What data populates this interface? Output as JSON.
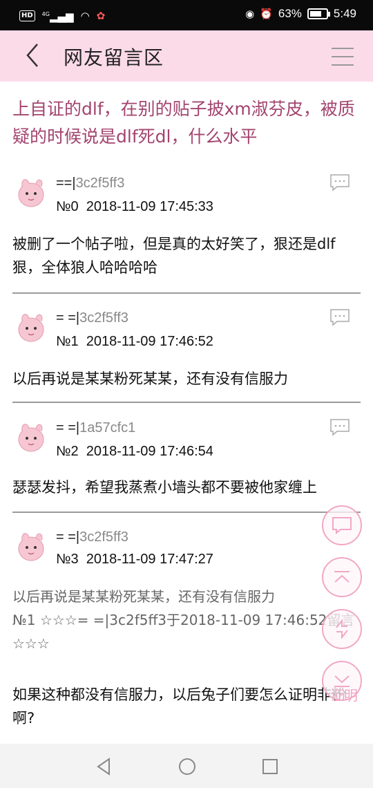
{
  "status_bar": {
    "hd_label": "HD",
    "network_label": "4G",
    "battery_percent": "63%",
    "battery_level": 0.63,
    "time": "5:49"
  },
  "header": {
    "title": "网友留言区"
  },
  "topic": {
    "title": "上自证的dlf，在别的贴子披xm淑芬皮，被质疑的时候说是dlf死dl，什么水平"
  },
  "posts": [
    {
      "author_prefix": "==|",
      "author_id": "3c2f5ff3",
      "floor": "№0",
      "timestamp": "2018-11-09 17:45:33",
      "body": "被删了一个帖子啦，但是真的太好笑了，狠还是dlf狠，全体狼人哈哈哈哈"
    },
    {
      "author_prefix": "= =|",
      "author_id": "3c2f5ff3",
      "floor": "№1",
      "timestamp": "2018-11-09 17:46:52",
      "body": "以后再说是某某粉死某某，还有没有信服力"
    },
    {
      "author_prefix": "= =|",
      "author_id": "1a57cfc1",
      "floor": "№2",
      "timestamp": "2018-11-09 17:46:54",
      "body": "瑟瑟发抖，希望我蒸煮小墙头都不要被他家缠上"
    },
    {
      "author_prefix": "= =|",
      "author_id": "3c2f5ff3",
      "floor": "№3",
      "timestamp": "2018-11-09 17:47:27",
      "quote": "以后再说是某某粉死某某，还有没有信服力\n№1 ☆☆☆= =|3c2f5ff3于2018-11-09 17:46:52留言☆☆☆",
      "body": "如果这种都没有信服力，以后兔子们要怎么证明非粉啊?"
    }
  ],
  "float_buttons": {
    "partial_label": "证明"
  },
  "colors": {
    "header_bg": "#fcdbe9",
    "topic_title": "#a3446f",
    "float_btn_border": "#f0a8c4",
    "divider": "#9a9a9a"
  },
  "icons": {
    "back": "back-arrow-icon",
    "menu": "menu-icon",
    "reply": "comment-icon",
    "float_comment": "comment-icon",
    "float_top": "scroll-top-icon",
    "float_refresh": "refresh-icon",
    "float_bottom": "scroll-bottom-icon"
  }
}
